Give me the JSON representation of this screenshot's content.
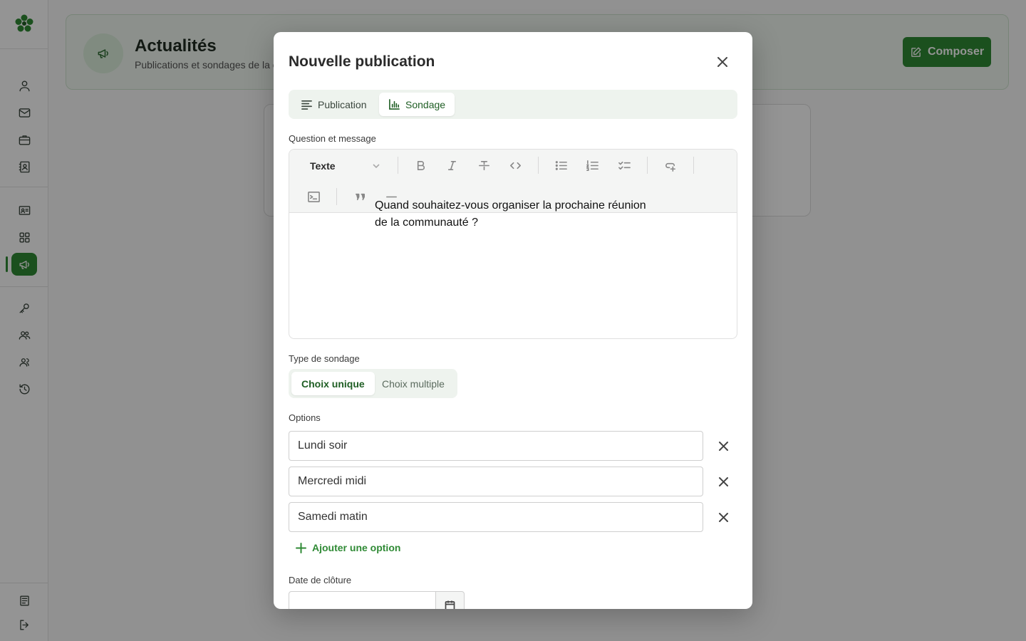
{
  "sidebar": {
    "items": [
      {
        "icon": "user-icon"
      },
      {
        "icon": "mail-icon"
      },
      {
        "icon": "briefcase-icon"
      },
      {
        "icon": "contacts-icon"
      },
      {
        "icon": "id-card-icon"
      },
      {
        "icon": "grid-icon"
      },
      {
        "icon": "megaphone-icon",
        "active": true
      },
      {
        "icon": "key-icon"
      },
      {
        "icon": "users-icon"
      },
      {
        "icon": "group-icon"
      },
      {
        "icon": "history-icon"
      },
      {
        "icon": "document-icon"
      },
      {
        "icon": "logout-icon"
      }
    ],
    "accent_color": "#2f8a35"
  },
  "page": {
    "title": "Actualités",
    "subtitle": "Publications et sondages de la c",
    "compose_label": "Composer"
  },
  "modal": {
    "title": "Nouvelle publication",
    "tabs": [
      {
        "label": "Publication",
        "active": false
      },
      {
        "label": "Sondage",
        "active": true
      }
    ],
    "question_label": "Question et message",
    "editor": {
      "block_type": "Texte",
      "content": "Quand souhaitez-vous organiser la prochaine réunion\nde la communauté ?"
    },
    "poll_type_label": "Type de sondage",
    "poll_types": [
      {
        "label": "Choix unique",
        "active": true
      },
      {
        "label": "Choix multiple",
        "active": false
      }
    ],
    "options_label": "Options",
    "options": [
      "Lundi soir",
      "Mercredi midi",
      "Samedi matin"
    ],
    "add_option_label": "Ajouter une option",
    "closing_date_label": "Date de clôture",
    "closing_date_value": ""
  }
}
